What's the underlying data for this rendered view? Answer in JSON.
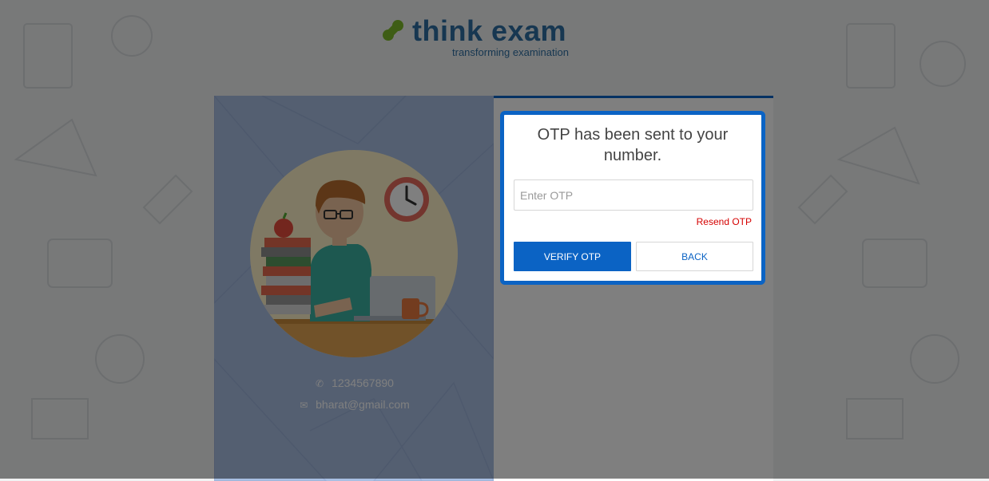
{
  "logo": {
    "name": "think exam",
    "tagline": "transforming examination"
  },
  "profile": {
    "phone": "1234567890",
    "email": "bharat@gmail.com",
    "phone_icon": "phone-icon",
    "email_icon": "envelope-icon"
  },
  "modal": {
    "title": "OTP has been sent to your number.",
    "otp_placeholder": "Enter OTP",
    "otp_value": "",
    "resend_label": "Resend OTP",
    "verify_label": "VERIFY OTP",
    "back_label": "BACK"
  },
  "colors": {
    "accent": "#0b63c4",
    "brand_text": "#2e6fa3",
    "brand_mark": "#7dbb2a",
    "resend": "#d50000",
    "panel": "#a9bfe3"
  }
}
